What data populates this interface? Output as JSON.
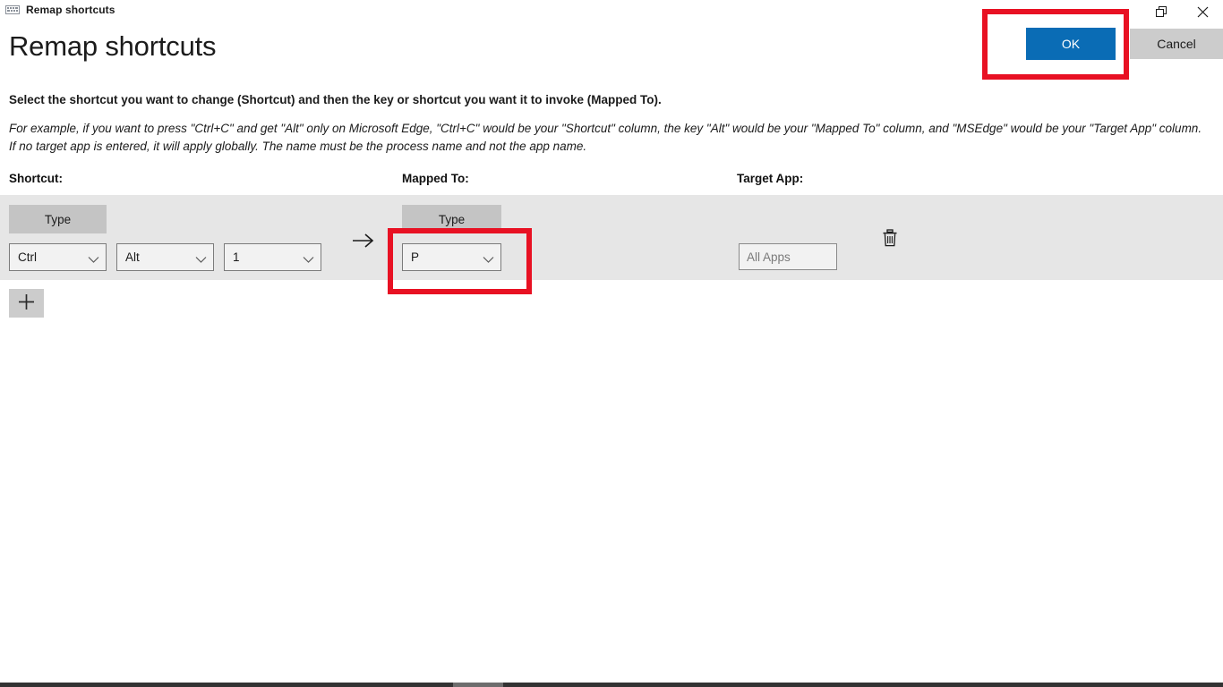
{
  "window": {
    "titlebar_text": "Remap shortcuts",
    "app_icon": "keyboard-icon",
    "controls": {
      "restore_icon": "restore-window-icon",
      "close_icon": "close-icon"
    }
  },
  "dialog": {
    "title": "Remap shortcuts",
    "ok_label": "OK",
    "cancel_label": "Cancel",
    "instructions_bold": "Select the shortcut you want to change (Shortcut) and then the key or shortcut you want it to invoke (Mapped To).",
    "instructions_italic_line1": "For example, if you want to press \"Ctrl+C\" and get \"Alt\" only on Microsoft Edge, \"Ctrl+C\" would be your \"Shortcut\" column, the key \"Alt\" would be your \"Mapped To\" column, and \"MSEdge\" would be your \"Target App\" column.",
    "instructions_italic_line2": "If no target app is entered, it will apply globally. The name must be the process name and not the app name."
  },
  "columns": {
    "shortcut": "Shortcut:",
    "mapped_to": "Mapped To:",
    "target_app": "Target App:"
  },
  "row": {
    "shortcut_type_label": "Type",
    "mapped_type_label": "Type",
    "shortcut_keys": [
      "Ctrl",
      "Alt",
      "1"
    ],
    "mapped_keys": [
      "P"
    ],
    "arrow_glyph": "arrow-right-icon",
    "target_app_value": "",
    "target_app_placeholder": "All Apps",
    "delete_icon": "trash-icon"
  },
  "add_row": {
    "label": "+",
    "icon": "plus-icon"
  },
  "colors": {
    "accent": "#0a6cb5",
    "highlight": "#e81123",
    "row_band": "#e6e6e6",
    "type_button": "#c4c4c4",
    "cancel_button": "#cccccc",
    "combo_fill": "#f2f2f2",
    "combo_border": "#7b7b7b"
  },
  "annotations": [
    {
      "name": "ok-button-highlight",
      "target": "ok-button"
    },
    {
      "name": "mapped-to-highlight",
      "target": "mapped-to-key-combo"
    }
  ]
}
